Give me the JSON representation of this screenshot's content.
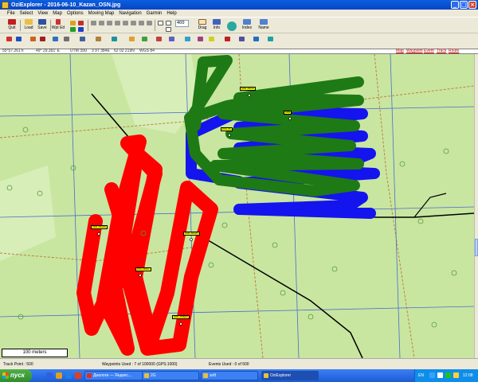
{
  "window": {
    "title": "OziExplorer - 2016-06-10_Kazan_OSN.jpg",
    "controls": [
      "_",
      "□",
      "×"
    ]
  },
  "menu": [
    "File",
    "Select",
    "View",
    "Map",
    "Options",
    "Moving Map",
    "Navigation",
    "Garmin",
    "Help"
  ],
  "toolbar": {
    "quit": "Quit",
    "load": "Load",
    "save": "Save",
    "wpt_ed": "Wpt Ed",
    "zoom_value": "400",
    "drag": "Drag",
    "info": "Info",
    "index": "Index",
    "name": "Name"
  },
  "coords": {
    "lat": "55°57.261'n",
    "lon": "49° 29.391' E",
    "utm_zone": "UTM 39U",
    "easting": "3 97 384E",
    "northing": "62 02 219N",
    "datum": "WGS 84",
    "tabs": [
      "Map",
      "Waypoint",
      "Event",
      "Track",
      "Route"
    ]
  },
  "waypoints": [
    {
      "label": "KOR 2ROG"
    },
    {
      "label": "KVA 2b"
    },
    {
      "label": "KOR 2RAZA"
    },
    {
      "label": "KOR 2RAZA"
    },
    {
      "label": "KOR"
    },
    {
      "label": "KVA 2ROG"
    },
    {
      "label": "KOR 2MNOA"
    }
  ],
  "scale": "100 meters",
  "status": {
    "track_point": "Track Point : 500",
    "waypoints_used": "Waypoints Used : 7 of 100000   (GPS:1000)",
    "events_used": "Events Used : 0 of 500"
  },
  "taskbar": {
    "start": "пуск",
    "tasks": [
      "Диалоги — Яндекс...",
      "2G",
      "soft",
      "OziExplorer"
    ],
    "lang": "EN",
    "clock": "12:08"
  },
  "colors": {
    "map_bg": "#c8e6a0",
    "track_red": "#ff0000",
    "track_green": "#1e7a14",
    "track_blue": "#1414ee",
    "grid": "#4a6cd0",
    "waypoint": "#ffff00"
  }
}
